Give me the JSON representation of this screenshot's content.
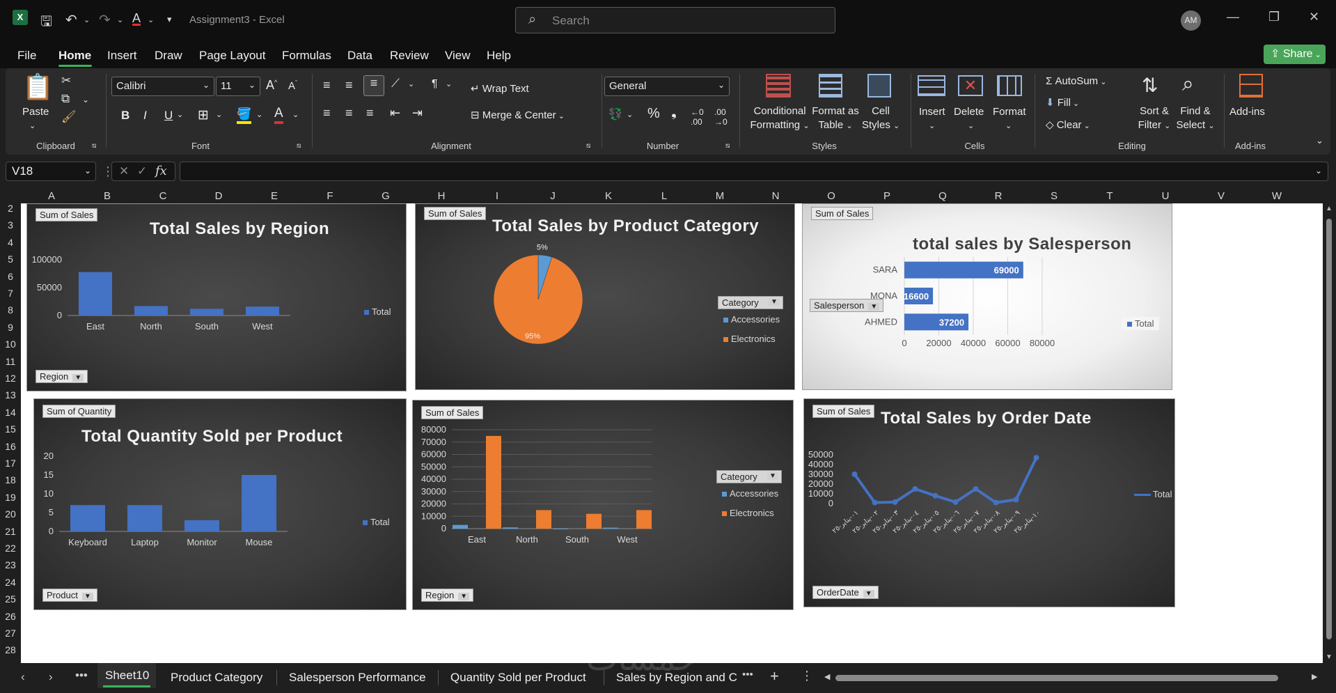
{
  "titlebar": {
    "doc_title": "Assignment3  -  Excel",
    "search_placeholder": "Search",
    "avatar_initials": "AM"
  },
  "menu": {
    "tabs": [
      "File",
      "Home",
      "Insert",
      "Draw",
      "Page Layout",
      "Formulas",
      "Data",
      "Review",
      "View",
      "Help"
    ],
    "active": "Home",
    "share_label": "Share"
  },
  "ribbon": {
    "clipboard": {
      "paste": "Paste",
      "label": "Clipboard"
    },
    "font": {
      "name": "Calibri",
      "size": "11",
      "label": "Font"
    },
    "alignment": {
      "wrap": "Wrap Text",
      "merge": "Merge & Center",
      "label": "Alignment"
    },
    "number": {
      "format": "General",
      "label": "Number"
    },
    "styles": {
      "conditional": "Conditional",
      "conditional2": "Formatting",
      "format_as": "Format as",
      "format_as2": "Table",
      "cell": "Cell",
      "cell2": "Styles",
      "label": "Styles"
    },
    "cells": {
      "insert": "Insert",
      "delete": "Delete",
      "format": "Format",
      "label": "Cells"
    },
    "editing": {
      "autosum": "AutoSum",
      "fill": "Fill",
      "clear": "Clear",
      "sort": "Sort &",
      "sort2": "Filter",
      "find": "Find &",
      "find2": "Select",
      "label": "Editing"
    },
    "addins": {
      "name": "Add-ins",
      "label": "Add-ins"
    }
  },
  "formula_bar": {
    "cell_ref": "V18",
    "formula": ""
  },
  "columns": [
    "A",
    "B",
    "C",
    "D",
    "E",
    "F",
    "G",
    "H",
    "I",
    "J",
    "K",
    "L",
    "M",
    "N",
    "O",
    "P",
    "Q",
    "R",
    "S",
    "T",
    "U",
    "V",
    "W"
  ],
  "rows": [
    "2",
    "3",
    "4",
    "5",
    "6",
    "7",
    "8",
    "9",
    "10",
    "11",
    "12",
    "13",
    "14",
    "15",
    "16",
    "17",
    "18",
    "19",
    "20",
    "21",
    "22",
    "23",
    "24",
    "25",
    "26",
    "27",
    "28"
  ],
  "charts": {
    "region": {
      "pill": "Sum of Sales",
      "title": "Total Sales by Region",
      "filter": "Region",
      "legend": "Total"
    },
    "category": {
      "pill": "Sum of Sales",
      "title": "Total Sales by Product Category",
      "filter": "Category",
      "legend": [
        "Accessories",
        "Electronics"
      ],
      "labels": [
        "5%",
        "95%"
      ]
    },
    "salesperson": {
      "pill": "Sum of Sales",
      "title": "total sales by Salesperson",
      "filter": "Salesperson",
      "legend": "Total"
    },
    "quantity": {
      "pill": "Sum of Quantity",
      "title": "Total Quantity Sold per Product",
      "filter": "Product",
      "legend": "Total"
    },
    "region_category": {
      "pill": "Sum of Sales",
      "filter": "Region",
      "legend_title": "Category",
      "legend": [
        "Accessories",
        "Electronics"
      ]
    },
    "orderdate": {
      "pill": "Sum of Sales",
      "title": "Total Sales by Order Date",
      "filter": "OrderDate",
      "legend": "Total"
    }
  },
  "chart_data": [
    {
      "type": "bar",
      "title": "Total Sales by Region",
      "categories": [
        "East",
        "North",
        "South",
        "West"
      ],
      "values": [
        78000,
        17000,
        12000,
        16000
      ],
      "yticks": [
        "0",
        "50000",
        "100000"
      ],
      "ylim": [
        0,
        110000
      ],
      "series_color": "#4472c4"
    },
    {
      "type": "pie",
      "title": "Total Sales by Product Category",
      "categories": [
        "Accessories",
        "Electronics"
      ],
      "values": [
        5,
        95
      ],
      "colors": [
        "#5b9bd5",
        "#ed7d31"
      ]
    },
    {
      "type": "bar",
      "title": "total sales by Salesperson",
      "categories": [
        "SARA",
        "MONA",
        "AHMED"
      ],
      "values": [
        69000,
        16600,
        37200
      ],
      "xticks": [
        "0",
        "20000",
        "40000",
        "60000",
        "80000"
      ],
      "xlim": [
        0,
        80000
      ],
      "series_color": "#4472c4"
    },
    {
      "type": "bar",
      "title": "Total Quantity Sold per Product",
      "categories": [
        "Keyboard",
        "Laptop",
        "Monitor",
        "Mouse"
      ],
      "values": [
        7,
        7,
        3,
        15
      ],
      "yticks": [
        "0",
        "5",
        "10",
        "15",
        "20"
      ],
      "ylim": [
        0,
        20
      ],
      "series_color": "#4472c4"
    },
    {
      "type": "bar",
      "categories": [
        "East",
        "North",
        "South",
        "West"
      ],
      "series": [
        {
          "name": "Accessories",
          "values": [
            3000,
            1000,
            0,
            800
          ],
          "color": "#5b9bd5"
        },
        {
          "name": "Electronics",
          "values": [
            75000,
            15000,
            12000,
            15000
          ],
          "color": "#ed7d31"
        }
      ],
      "yticks": [
        "0",
        "10000",
        "20000",
        "30000",
        "40000",
        "50000",
        "60000",
        "70000",
        "80000"
      ],
      "ylim": [
        0,
        80000
      ]
    },
    {
      "type": "line",
      "title": "Total Sales by Order Date",
      "categories": [
        "٠١-يناير-٢٥",
        "٠٢-يناير-٢٥",
        "٠٣-يناير-٢٥",
        "٠٤-يناير-٢٥",
        "٠٥-يناير-٢٥",
        "٠٦-يناير-٢٥",
        "٠٧-يناير-٢٥",
        "٠٨-يناير-٢٥",
        "٠٩-يناير-٢٥",
        "١٠-يناير-٢٥"
      ],
      "values": [
        30000,
        1000,
        1500,
        15000,
        8000,
        1500,
        15000,
        1000,
        4000,
        47000
      ],
      "yticks": [
        "0",
        "10000",
        "20000",
        "30000",
        "40000",
        "50000"
      ],
      "ylim": [
        0,
        50000
      ],
      "series_color": "#4472c4"
    }
  ],
  "sheet_tabs": [
    "Sheet10",
    "Product Category",
    "Salesperson Performance",
    "Quantity Sold per Product",
    "Sales by Region and C"
  ],
  "active_sheet": "Sheet10",
  "watermark": "خمسات"
}
